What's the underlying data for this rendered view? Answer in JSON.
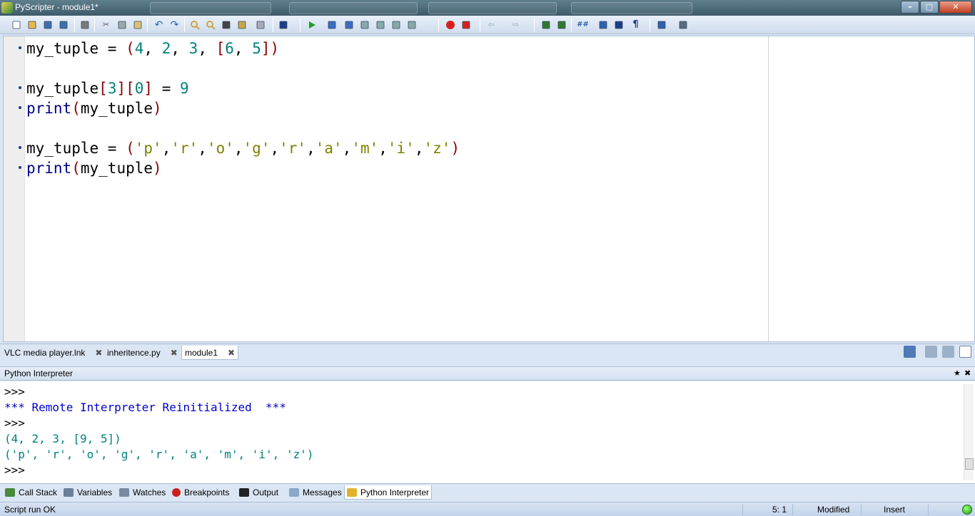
{
  "window": {
    "title": "PyScripter - module1*",
    "min_glyph": "–",
    "max_glyph": "□",
    "close_glyph": "✕"
  },
  "toolbar": {
    "icons": [
      "new-file-icon",
      "open-icon",
      "save-icon",
      "save-all-icon",
      "print-icon",
      "cut-icon",
      "copy-icon",
      "paste-icon",
      "undo-icon",
      "redo-icon",
      "find-icon",
      "find-next-icon",
      "replace-icon",
      "find-in-files-icon",
      "goto-icon",
      "syntax-check-icon",
      "run-icon",
      "debug-icon",
      "step-into-icon",
      "step-over-icon",
      "step-out-icon",
      "pause-icon",
      "abort-icon",
      "toggle-breakpoint-icon",
      "clear-breakpoints-icon",
      "back-icon",
      "forward-icon",
      "indent-icon",
      "dedent-icon",
      "comment-icon",
      "uncomment-icon",
      "toggle-view-icon",
      "whitespace-icon",
      "layout-icon",
      "layouts-icon"
    ]
  },
  "editor": {
    "lines": [
      [
        [
          "id",
          "my_tuple"
        ],
        [
          "op",
          " = "
        ],
        [
          "br",
          "("
        ],
        [
          "num",
          "4"
        ],
        [
          "op",
          ", "
        ],
        [
          "num",
          "2"
        ],
        [
          "op",
          ", "
        ],
        [
          "num",
          "3"
        ],
        [
          "op",
          ", "
        ],
        [
          "br",
          "["
        ],
        [
          "num",
          "6"
        ],
        [
          "op",
          ", "
        ],
        [
          "num",
          "5"
        ],
        [
          "br",
          "])"
        ]
      ],
      [
        [
          "id",
          "my_tuple"
        ],
        [
          "br",
          "["
        ],
        [
          "num",
          "3"
        ],
        [
          "br",
          "]["
        ],
        [
          "num",
          "0"
        ],
        [
          "br",
          "]"
        ],
        [
          "op",
          " = "
        ],
        [
          "num",
          "9"
        ]
      ],
      [
        [
          "kw",
          "print"
        ],
        [
          "br",
          "("
        ],
        [
          "id",
          "my_tuple"
        ],
        [
          "br",
          ")"
        ]
      ],
      [
        [
          "id",
          "my_tuple"
        ],
        [
          "op",
          " = "
        ],
        [
          "br",
          "("
        ],
        [
          "str",
          "'p'"
        ],
        [
          "op",
          ","
        ],
        [
          "str",
          "'r'"
        ],
        [
          "op",
          ","
        ],
        [
          "str",
          "'o'"
        ],
        [
          "op",
          ","
        ],
        [
          "str",
          "'g'"
        ],
        [
          "op",
          ","
        ],
        [
          "str",
          "'r'"
        ],
        [
          "op",
          ","
        ],
        [
          "str",
          "'a'"
        ],
        [
          "op",
          ","
        ],
        [
          "str",
          "'m'"
        ],
        [
          "op",
          ","
        ],
        [
          "str",
          "'i'"
        ],
        [
          "op",
          ","
        ],
        [
          "str",
          "'z'"
        ],
        [
          "br",
          ")"
        ]
      ],
      [
        [
          "kw",
          "print"
        ],
        [
          "br",
          "("
        ],
        [
          "id",
          "my_tuple"
        ],
        [
          "br",
          ")"
        ]
      ]
    ]
  },
  "file_tabs": [
    {
      "label": "VLC media player.lnk",
      "close": "✖"
    },
    {
      "label": "inheritence.py",
      "close": "✖"
    },
    {
      "label": "module1",
      "close": "✖"
    }
  ],
  "interpreter": {
    "title": "Python Interpreter",
    "pin_glyph": "★",
    "close_glyph": "✖",
    "output": [
      {
        "kind": "prompt",
        "text": ">>>"
      },
      {
        "kind": "info",
        "text": "*** Remote Interpreter Reinitialized  ***"
      },
      {
        "kind": "prompt",
        "text": ">>>"
      },
      {
        "kind": "result",
        "text": "(4, 2, 3, [9, 5])"
      },
      {
        "kind": "result",
        "text": "('p', 'r', 'o', 'g', 'r', 'a', 'm', 'i', 'z')"
      },
      {
        "kind": "prompt",
        "text": ">>>"
      }
    ]
  },
  "bottom_tabs": [
    {
      "label": "Call Stack",
      "icon": "call-stack-icon",
      "color": "#4a8a3a"
    },
    {
      "label": "Variables",
      "icon": "variables-icon",
      "color": "#6a7f9a"
    },
    {
      "label": "Watches",
      "icon": "watches-icon",
      "color": "#7a8aa0"
    },
    {
      "label": "Breakpoints",
      "icon": "breakpoints-icon",
      "color": "#cc1f1f"
    },
    {
      "label": "Output",
      "icon": "output-icon",
      "color": "#222222"
    },
    {
      "label": "Messages",
      "icon": "messages-icon",
      "color": "#8aa8c8"
    },
    {
      "label": "Python Interpreter",
      "icon": "python-icon",
      "color": "#e0b32a"
    }
  ],
  "status": {
    "message": "Script run OK",
    "position": "5: 1",
    "modified": "Modified",
    "mode": "Insert"
  }
}
